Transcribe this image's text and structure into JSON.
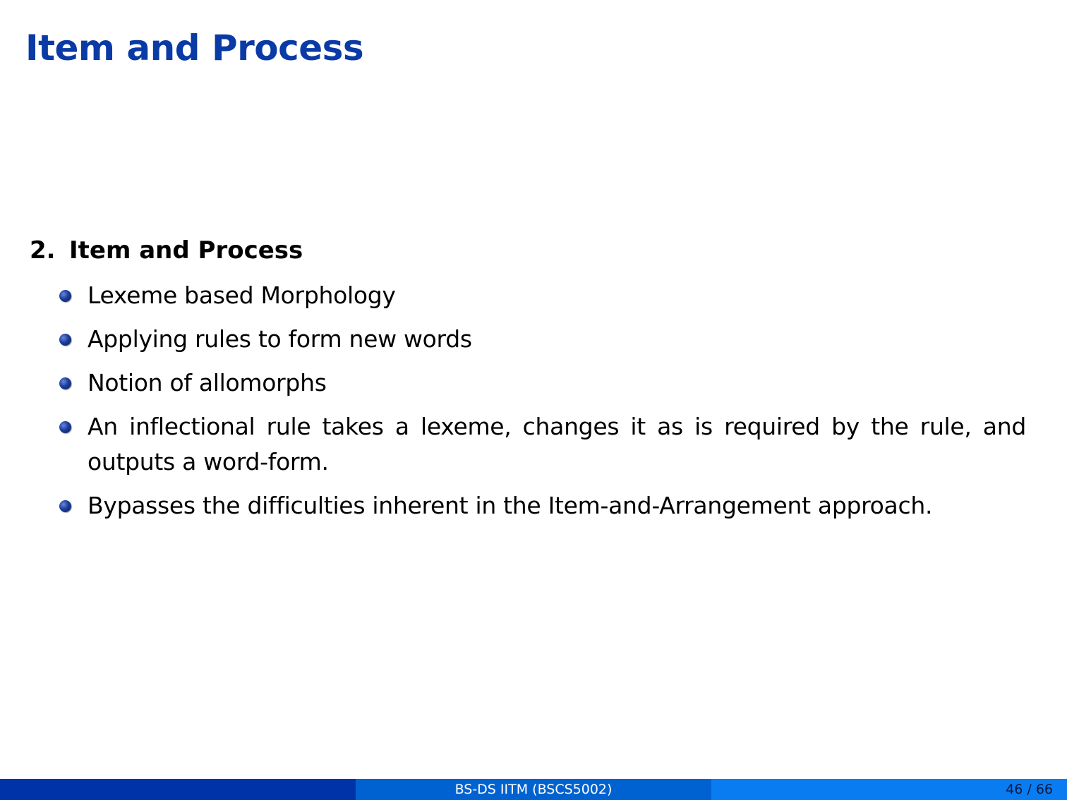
{
  "slide": {
    "title": "Item and Process"
  },
  "section": {
    "number": "2.",
    "heading": "Item and Process",
    "bullets": [
      {
        "text": "Lexeme based Morphology"
      },
      {
        "text": "Applying rules to form new words"
      },
      {
        "text": "Notion of allomorphs"
      },
      {
        "text": "An inflectional rule takes a lexeme, changes it as is required by the rule, and outputs a word-form."
      },
      {
        "text": "Bypasses the difficulties inherent in the Item-and-Arrangement approach."
      }
    ]
  },
  "footer": {
    "left_text": "",
    "center_text": "BS-DS IITM (BSCS5002)",
    "page_indicator": "46 / 66"
  },
  "colors": {
    "title": "#0a3aa6",
    "footer_left": "#0033a8",
    "footer_center": "#0062d0",
    "footer_right": "#0a7cf2"
  }
}
